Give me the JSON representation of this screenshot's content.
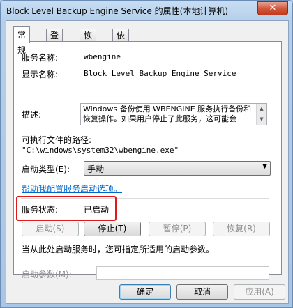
{
  "window": {
    "title": "Block Level Backup Engine Service 的属性(本地计算机)",
    "close_glyph": "✕"
  },
  "tabs": [
    {
      "label": "常规"
    },
    {
      "label": "登录"
    },
    {
      "label": "恢复"
    },
    {
      "label": "依存关系"
    }
  ],
  "general": {
    "service_name_label": "服务名称:",
    "service_name": "wbengine",
    "display_name_label": "显示名称:",
    "display_name": "Block Level Backup Engine Service",
    "description_label": "描述:",
    "description": "Windows 备份使用 WBENGINE 服务执行备份和恢复操作。如果用户停止了此服务，这可能会",
    "path_label": "可执行文件的路径:",
    "path": "\"C:\\windows\\system32\\wbengine.exe\"",
    "startup_type_label": "启动类型(E):",
    "startup_type": "手动",
    "help_link": "帮助我配置服务启动选项。",
    "status_label": "服务状态:",
    "status_value": "已启动",
    "buttons": {
      "start": "启动(S)",
      "stop": "停止(T)",
      "pause": "暂停(P)",
      "resume": "恢复(R)"
    },
    "start_hint": "当从此处启动服务时，您可指定所适用的启动参数。",
    "start_params_label": "启动参数(M):",
    "start_params_value": ""
  },
  "footer": {
    "ok": "确定",
    "cancel": "取消",
    "apply": "应用(A)"
  }
}
